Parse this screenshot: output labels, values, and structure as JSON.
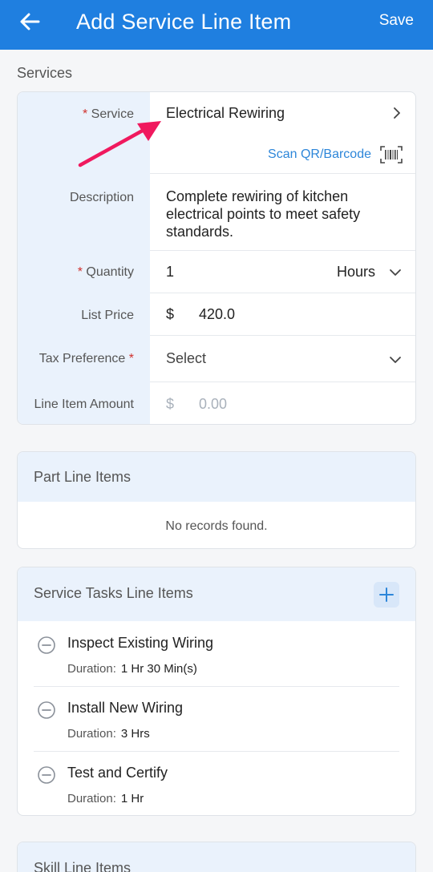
{
  "header": {
    "title": "Add Service Line Item",
    "save_label": "Save",
    "color": "#1f7fe0"
  },
  "services": {
    "section_label": "Services",
    "service": {
      "label": "Service",
      "required_mark": "*",
      "value": "Electrical Rewiring"
    },
    "scan_label": "Scan QR/Barcode",
    "description": {
      "label": "Description",
      "value": "Complete rewiring of kitchen electrical points to meet safety standards."
    },
    "quantity": {
      "label": "Quantity",
      "required_mark": "*",
      "value": "1",
      "unit": "Hours"
    },
    "list_price": {
      "label": "List Price",
      "currency": "$",
      "value": "420.0"
    },
    "tax_preference": {
      "label": "Tax Preference",
      "required_mark": "*",
      "value": "Select"
    },
    "line_item_amount": {
      "label": "Line Item Amount",
      "currency": "$",
      "value": "0.00"
    }
  },
  "part_line_items": {
    "title": "Part Line Items",
    "empty_text": "No records found."
  },
  "service_tasks": {
    "title": "Service Tasks Line Items",
    "duration_label": "Duration:",
    "items": [
      {
        "name": "Inspect Existing Wiring",
        "duration": "1 Hr 30 Min(s)"
      },
      {
        "name": "Install New Wiring",
        "duration": "3 Hrs"
      },
      {
        "name": "Test and Certify",
        "duration": "1 Hr"
      }
    ]
  },
  "skill_line_items": {
    "title": "Skill Line Items"
  },
  "annotation": {
    "color": "#f0195e"
  }
}
